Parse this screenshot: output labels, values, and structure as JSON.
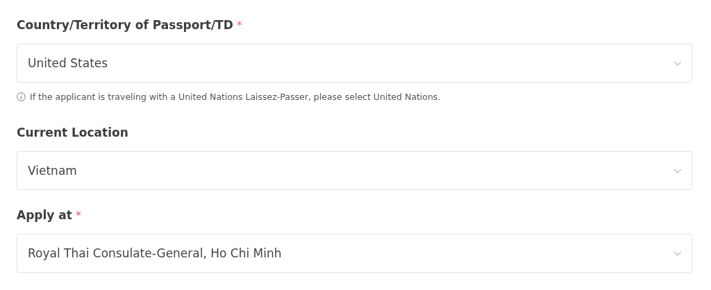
{
  "fields": [
    {
      "label": "Country/Territory of Passport/TD",
      "required_mark": "*",
      "value": "United States",
      "hint": "If the applicant is traveling with a United Nations Laissez-Passer, please select United Nations."
    },
    {
      "label": "Current Location",
      "value": "Vietnam"
    },
    {
      "label": "Apply at",
      "required_mark": "*",
      "value": "Royal Thai Consulate-General, Ho Chi Minh"
    }
  ]
}
